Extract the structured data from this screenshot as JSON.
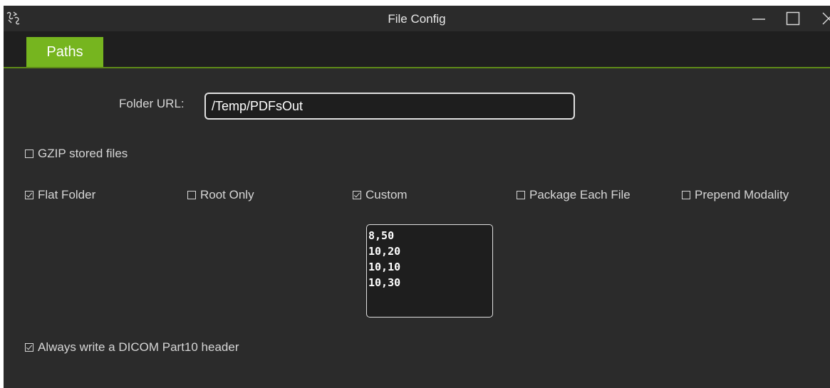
{
  "window": {
    "title": "File Config",
    "icon": "app-logo-icon",
    "controls": [
      "minimize-icon",
      "maximize-icon",
      "close-icon"
    ]
  },
  "tabs": [
    {
      "label": "Paths",
      "active": true
    }
  ],
  "paths": {
    "folder_url_label": "Folder URL:",
    "folder_url_value": "/Temp/PDFsOut",
    "gzip": {
      "label": "GZIP stored files",
      "checked": false
    },
    "flat_folder": {
      "label": "Flat Folder",
      "checked": true
    },
    "root_only": {
      "label": "Root Only",
      "checked": false
    },
    "custom": {
      "label": "Custom",
      "checked": true
    },
    "package_each_file": {
      "label": "Package Each File",
      "checked": false
    },
    "prepend_modality": {
      "label": "Prepend Modality",
      "checked": false
    },
    "custom_values": "8,50\n10,20\n10,10\n10,30",
    "dicom_header": {
      "label": "Always write a DICOM Part10 header",
      "checked": true
    }
  },
  "colors": {
    "accent": "#76b51f",
    "background": "#2b2b2b",
    "text": "#d6d6d6"
  }
}
